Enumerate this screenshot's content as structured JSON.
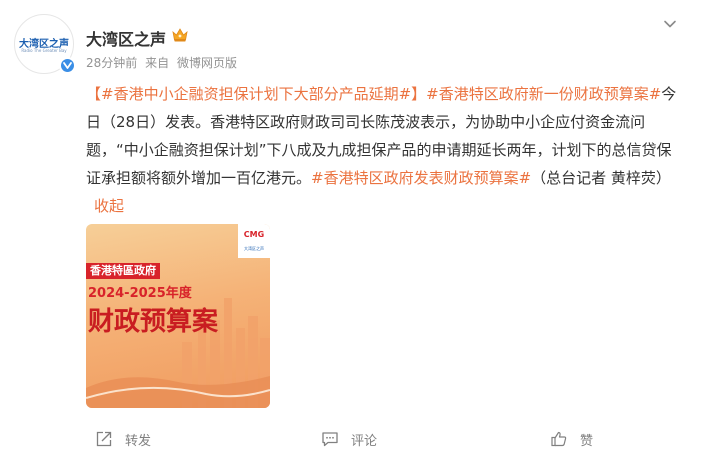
{
  "post": {
    "author": {
      "name": "大湾区之声",
      "avatar_text": "大湾区之声",
      "avatar_subtext": "Radio The Greater Bay"
    },
    "meta": {
      "time": "28分钟前",
      "source_prefix": "来自",
      "source": "微博网页版"
    },
    "body": {
      "tag1": "【#香港中小企融资担保计划下大部分产品延期#】",
      "tag2": "#香港特区政府新一份财政预算案#",
      "text1": "今日（28日）发表。香港特区政府财政司司长陈茂波表示，为协助中小企应付资金流问题，“中小企融资担保计划”下八成及九成担保产品的申请期延长两年，计划下的总信贷保证承担额将额外增加一百亿港元。",
      "tag3": "#香港特区政府发表财政预算案#",
      "text2": "（总台记者 黄梓荧）",
      "collapse": "收起"
    },
    "image": {
      "logo": "CMG",
      "logo_sub": "大湾区之声",
      "line1": "香港特區政府",
      "line2": "2024-2025年度",
      "line3": "财政预算案"
    },
    "actions": {
      "repost": "转发",
      "comment": "评论",
      "like": "赞"
    }
  },
  "colors": {
    "accent": "#eb7340",
    "verified": "#3a8ee6",
    "muted": "#939393"
  }
}
